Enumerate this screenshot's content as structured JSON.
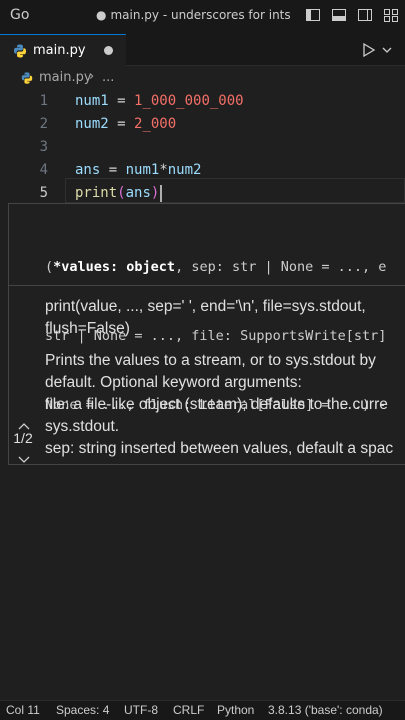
{
  "titlebar": {
    "menu_go": "Go",
    "dirty_marker": "●",
    "title": "main.py - underscores for ints - ...",
    "icons": [
      "toggle-primary-sidebar-icon",
      "toggle-panel-icon",
      "toggle-secondary-sidebar-icon",
      "customize-layout-icon"
    ]
  },
  "tab": {
    "label": "main.py",
    "icon": "python-file-icon"
  },
  "breadcrumb": {
    "file": "main.py",
    "separator": "›",
    "more": "..."
  },
  "editor": {
    "lines": [
      {
        "number": "1",
        "tokens": [
          {
            "t": "num1",
            "c": "var"
          },
          {
            "t": " = ",
            "c": "op"
          },
          {
            "t": "1_000_000_000",
            "c": "num"
          }
        ]
      },
      {
        "number": "2",
        "tokens": [
          {
            "t": "num2",
            "c": "var"
          },
          {
            "t": " = ",
            "c": "op"
          },
          {
            "t": "2_000",
            "c": "num"
          }
        ]
      },
      {
        "number": "3",
        "tokens": []
      },
      {
        "number": "4",
        "tokens": [
          {
            "t": "ans",
            "c": "var"
          },
          {
            "t": " = ",
            "c": "op"
          },
          {
            "t": "num1",
            "c": "var"
          },
          {
            "t": "*",
            "c": "op"
          },
          {
            "t": "num2",
            "c": "var"
          }
        ]
      },
      {
        "number": "5",
        "tokens": [
          {
            "t": "print",
            "c": "fn"
          },
          {
            "t": "(",
            "c": "paren"
          },
          {
            "t": "ans",
            "c": "var"
          },
          {
            "t": ")",
            "c": "paren"
          }
        ]
      }
    ],
    "active_line": "5"
  },
  "popup": {
    "signature_lines": [
      "(*values: object, sep: str | None = ..., e",
      "str | None = ..., file: SupportsWrite[str]",
      "None = ..., flush: Literal[False] = ...) -"
    ],
    "active_param": "*values: object",
    "doc_lines": [
      "print(value, ..., sep=' ', end='\\n', file=sys.stdout,",
      "flush=False)",
      "",
      "Prints the values to a stream, or to sys.stdout by",
      "default. Optional keyword arguments:",
      "file: a file-like object (stream); defaults to the curre",
      "sys.stdout.",
      "sep: string inserted between values, default a spac"
    ],
    "counter": "1/2"
  },
  "statusbar": {
    "col": "Col 11",
    "spaces": "Spaces: 4",
    "encoding": "UTF-8",
    "eol": "CRLF",
    "language": "Python",
    "interpreter": "3.8.13 ('base': conda)"
  },
  "colors": {
    "accent": "#0078d4",
    "number": "#f47067",
    "variable": "#9cdcfe",
    "function": "#dcdcaa",
    "bracket": "#da70d6"
  }
}
